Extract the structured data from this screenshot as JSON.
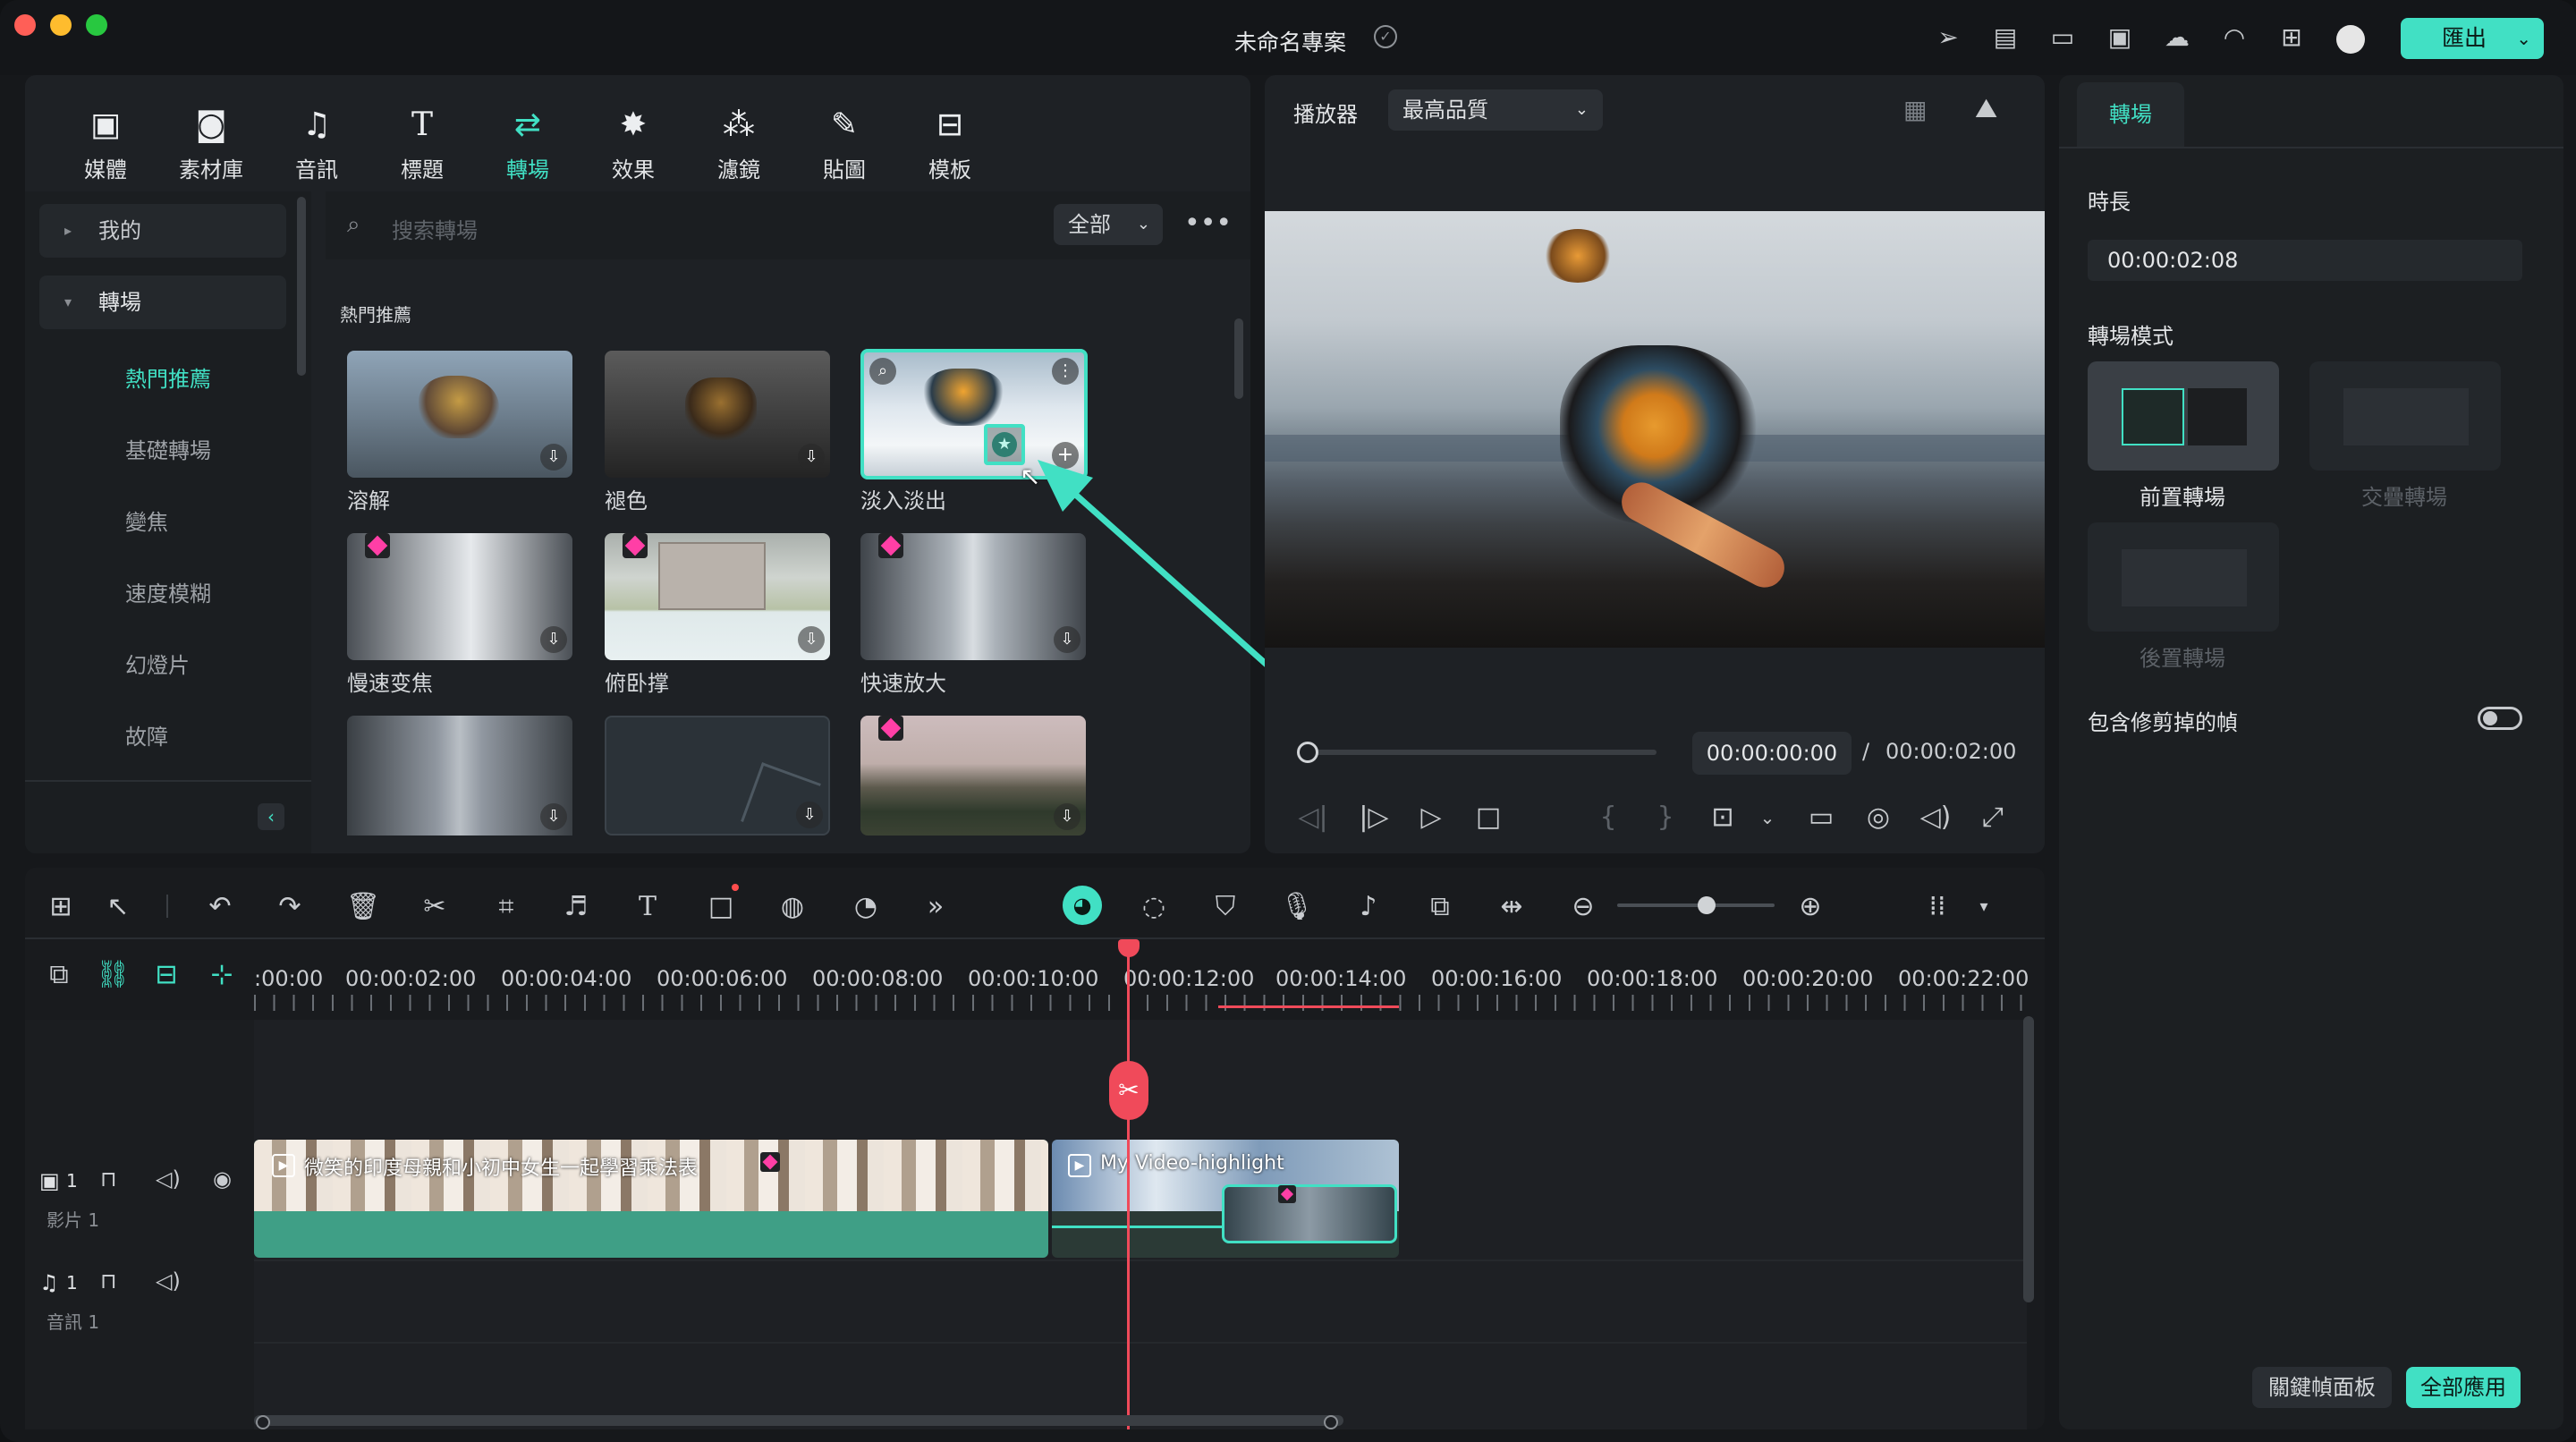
{
  "window": {
    "title": "未命名專案",
    "export_label": "匯出"
  },
  "media_tabs": [
    {
      "label": "媒體",
      "icon": "media-icon"
    },
    {
      "label": "素材庫",
      "icon": "stock-library-icon"
    },
    {
      "label": "音訊",
      "icon": "music-note-icon"
    },
    {
      "label": "標題",
      "icon": "text-title-icon"
    },
    {
      "label": "轉場",
      "icon": "transition-icon",
      "active": true
    },
    {
      "label": "效果",
      "icon": "effects-icon"
    },
    {
      "label": "濾鏡",
      "icon": "filters-icon"
    },
    {
      "label": "貼圖",
      "icon": "stickers-icon"
    },
    {
      "label": "模板",
      "icon": "templates-icon"
    }
  ],
  "sidebar": {
    "mine": "我的",
    "transitions": "轉場",
    "sub_items": [
      "熱門推薦",
      "基礎轉場",
      "變焦",
      "速度模糊",
      "幻燈片",
      "故障"
    ]
  },
  "library": {
    "search_placeholder": "搜索轉場",
    "filter_value": "全部",
    "section_title": "熱門推薦",
    "items": [
      {
        "label": "溶解"
      },
      {
        "label": "褪色"
      },
      {
        "label": "淡入淡出"
      },
      {
        "label": "慢速变焦"
      },
      {
        "label": "俯卧撑"
      },
      {
        "label": "快速放大"
      }
    ]
  },
  "player": {
    "label": "播放器",
    "quality": "最高品質",
    "current_time": "00:00:00:00",
    "separator": "/",
    "total_time": "00:00:02:00",
    "progress": 0.0
  },
  "properties": {
    "tab": "轉場",
    "duration_label": "時長",
    "duration_value": "00:00:02:08",
    "mode_label": "轉場模式",
    "modes": [
      "前置轉場",
      "交疊轉場",
      "後置轉場"
    ],
    "include_trimmed_label": "包含修剪掉的幀",
    "include_trimmed": false,
    "keyframe_panel_btn": "關鍵幀面板",
    "apply_all_btn": "全部應用"
  },
  "timeline": {
    "ruler": [
      ":00:00",
      "00:00:02:00",
      "00:00:04:00",
      "00:00:06:00",
      "00:00:08:00",
      "00:00:10:00",
      "00:00:12:00",
      "00:00:14:00",
      "00:00:16:00",
      "00:00:18:00",
      "00:00:20:00",
      "00:00:22:00"
    ],
    "video_track_label": "影片 1",
    "video_track_num": "1",
    "audio_track_label": "音訊 1",
    "audio_track_num": "1",
    "clips": [
      {
        "title": "微笑的印度母親和小初中女生一起學習乘法表"
      },
      {
        "title": "My Video-highlight"
      }
    ]
  },
  "colors": {
    "accent": "#41e0c4",
    "playhead": "#f04a5a",
    "clip_green": "#3f9f86"
  }
}
